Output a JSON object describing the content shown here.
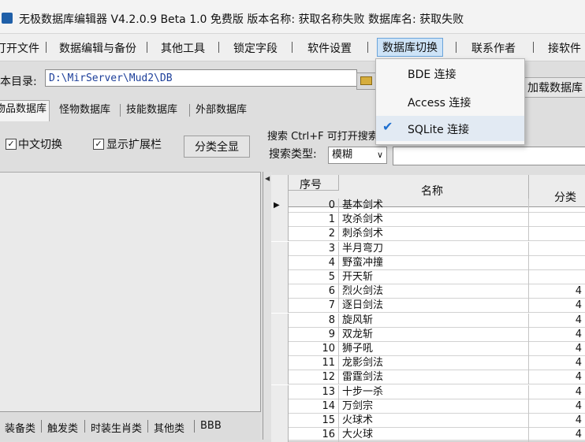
{
  "titlebar": {
    "title": "无极数据库编辑器 V4.2.0.9    Beta 1.0 免费版    版本名称: 获取名称失败    数据库名: 获取失败"
  },
  "menu": {
    "items": [
      "打开文件",
      "数据编辑与备份",
      "其他工具",
      "锁定字段",
      "软件设置",
      "数据库切换",
      "联系作者",
      "接软件"
    ]
  },
  "dropdown": {
    "items": [
      {
        "label": "BDE 连接",
        "checked": false
      },
      {
        "label": "Access 连接",
        "checked": false
      },
      {
        "label": "SQLite 连接",
        "checked": true
      }
    ],
    "check_icon": "checkmark-icon"
  },
  "directory": {
    "label": "本目录:",
    "path": "D:\\MirServer\\Mud2\\DB",
    "load_button": "加载数据库"
  },
  "tabs": [
    "物品数据库",
    "怪物数据库",
    "技能数据库",
    "外部数据库"
  ],
  "options": {
    "chinese_switch": "中文切换",
    "show_ext": "显示扩展栏",
    "classify_all": "分类全显",
    "search_hint": "搜索  Ctrl+F 可打开搜索框搜索",
    "search_type_label": "搜索类型:",
    "search_type_value": "模糊"
  },
  "grid": {
    "columns": [
      "序号",
      "名称",
      "分类"
    ],
    "rows": [
      {
        "idx": "0",
        "name": "基本剑术",
        "cat": ""
      },
      {
        "idx": "1",
        "name": "攻杀剑术",
        "cat": ""
      },
      {
        "idx": "2",
        "name": "刺杀剑术",
        "cat": ""
      },
      {
        "idx": "3",
        "name": "半月弯刀",
        "cat": ""
      },
      {
        "idx": "4",
        "name": "野蛮冲撞",
        "cat": ""
      },
      {
        "idx": "5",
        "name": "开天斩",
        "cat": ""
      },
      {
        "idx": "6",
        "name": "烈火剑法",
        "cat": "4"
      },
      {
        "idx": "7",
        "name": "逐日剑法",
        "cat": "4"
      },
      {
        "idx": "8",
        "name": "旋风斩",
        "cat": "4"
      },
      {
        "idx": "9",
        "name": "双龙斩",
        "cat": "4"
      },
      {
        "idx": "10",
        "name": "狮子吼",
        "cat": "4"
      },
      {
        "idx": "11",
        "name": "龙影剑法",
        "cat": "4"
      },
      {
        "idx": "12",
        "name": "雷霆剑法",
        "cat": "4"
      },
      {
        "idx": "13",
        "name": "十步一杀",
        "cat": "4"
      },
      {
        "idx": "14",
        "name": "万剑宗",
        "cat": "4"
      },
      {
        "idx": "15",
        "name": "火球术",
        "cat": "4"
      },
      {
        "idx": "16",
        "name": "大火球",
        "cat": "4"
      }
    ]
  },
  "bottom_tabs": [
    "装备类",
    "触发类",
    "时装生肖类",
    "其他类",
    "BBB"
  ]
}
